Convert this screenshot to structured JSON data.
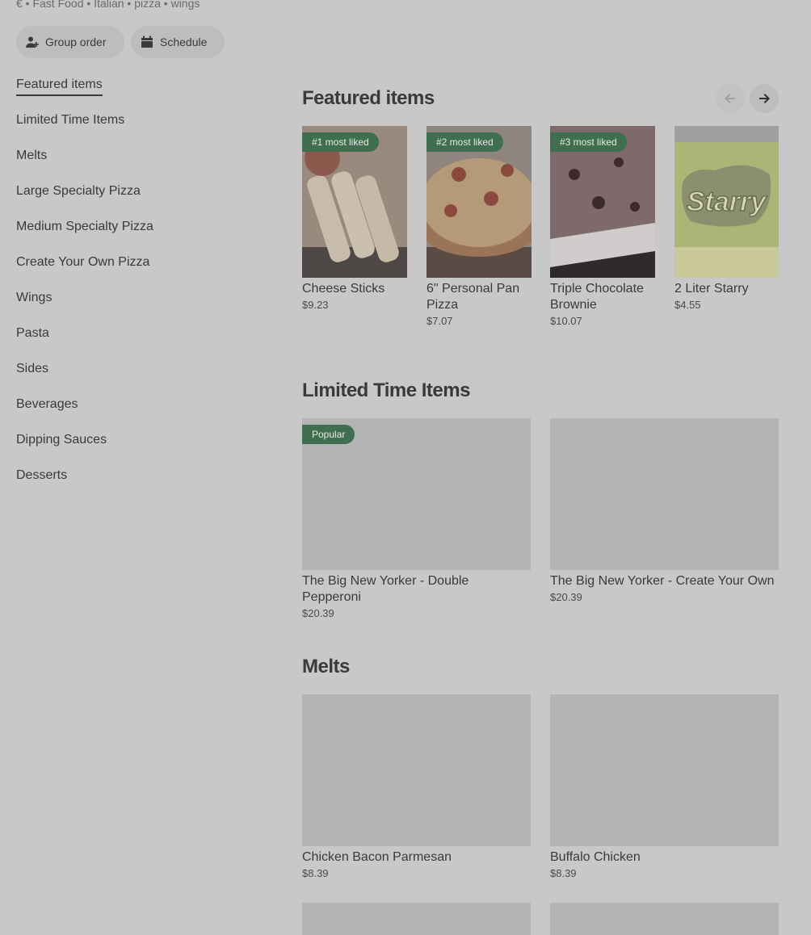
{
  "header": {
    "tags": "€ • Fast Food • Italian • pizza • wings",
    "group_order": "Group order",
    "schedule": "Schedule"
  },
  "nav": [
    {
      "label": "Featured items"
    },
    {
      "label": "Limited Time Items"
    },
    {
      "label": "Melts"
    },
    {
      "label": "Large Specialty Pizza"
    },
    {
      "label": "Medium Specialty Pizza"
    },
    {
      "label": "Create Your Own Pizza"
    },
    {
      "label": "Wings"
    },
    {
      "label": "Pasta"
    },
    {
      "label": "Sides"
    },
    {
      "label": "Beverages"
    },
    {
      "label": "Dipping Sauces"
    },
    {
      "label": "Desserts"
    }
  ],
  "featured": {
    "title": "Featured items",
    "items": [
      {
        "badge": "#1 most liked",
        "name": "Cheese Sticks",
        "price": "$9.23"
      },
      {
        "badge": "#2 most liked",
        "name": "6\" Personal Pan Pizza",
        "price": "$7.07"
      },
      {
        "badge": "#3 most liked",
        "name": "Triple Chocolate Brownie",
        "price": "$10.07"
      },
      {
        "badge": "",
        "name": "2 Liter Starry",
        "price": "$4.55"
      }
    ]
  },
  "limited": {
    "title": "Limited Time Items",
    "items": [
      {
        "badge": "Popular",
        "name": "The Big New Yorker - Double Pepperoni",
        "price": "$20.39"
      },
      {
        "badge": "",
        "name": "The Big New Yorker - Create Your Own",
        "price": "$20.39"
      }
    ]
  },
  "melts": {
    "title": "Melts",
    "items": [
      {
        "name": "Chicken Bacon Parmesan",
        "price": "$8.39"
      },
      {
        "name": "Buffalo Chicken",
        "price": "$8.39"
      }
    ]
  },
  "icons": {
    "group": "add-person-icon",
    "schedule": "calendar-icon",
    "prev": "arrow-left-icon",
    "next": "arrow-right-icon"
  },
  "colors": {
    "badge": "#3f6f4e",
    "background": "#c8c8c8"
  }
}
